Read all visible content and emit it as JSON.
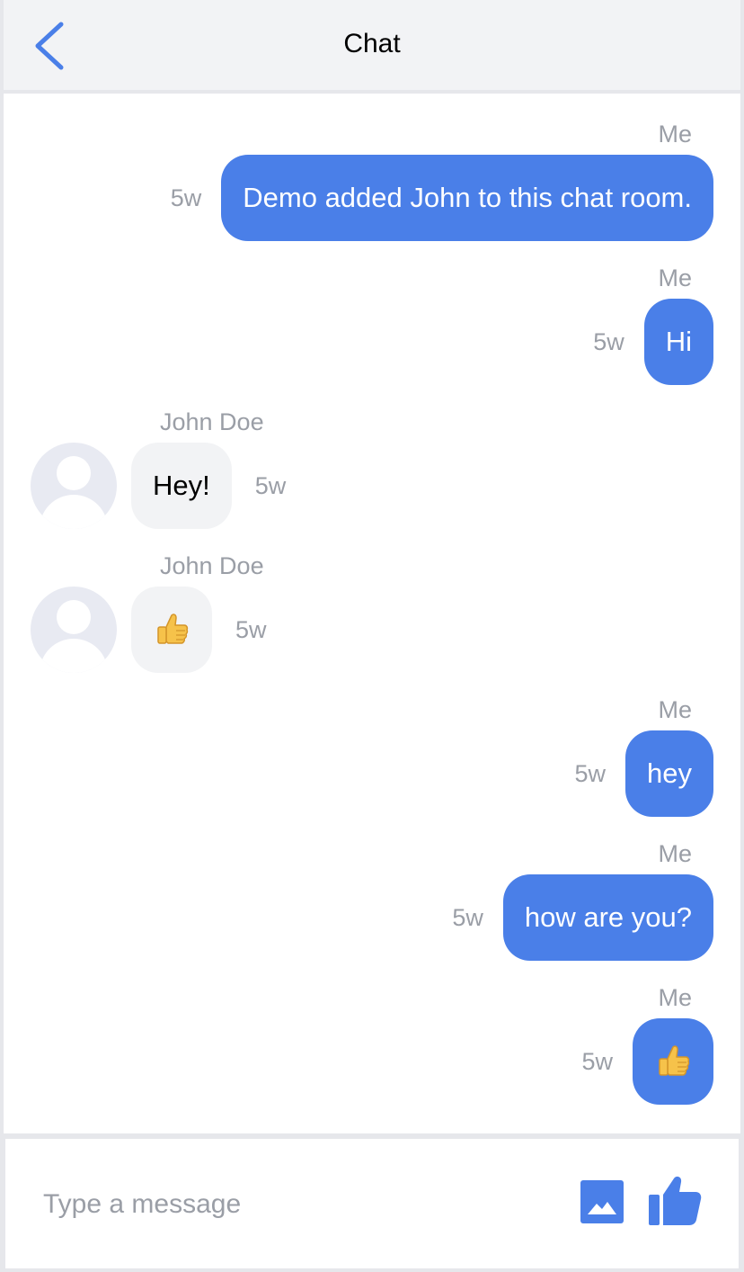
{
  "header": {
    "title": "Chat",
    "back_icon": "chevron-left-icon"
  },
  "colors": {
    "accent": "#4a7fe8",
    "incoming_bubble": "#f2f3f5",
    "muted_text": "#9a9ea6"
  },
  "messages": [
    {
      "sender": "Me",
      "text": "Demo added John to this chat room.",
      "time": "5w",
      "outgoing": true
    },
    {
      "sender": "Me",
      "text": "Hi",
      "time": "5w",
      "outgoing": true
    },
    {
      "sender": "John Doe",
      "text": "Hey!",
      "time": "5w",
      "outgoing": false
    },
    {
      "sender": "John Doe",
      "text": "👍",
      "time": "5w",
      "outgoing": false
    },
    {
      "sender": "Me",
      "text": "hey",
      "time": "5w",
      "outgoing": true
    },
    {
      "sender": "Me",
      "text": "how are you?",
      "time": "5w",
      "outgoing": true
    },
    {
      "sender": "Me",
      "text": "👍",
      "time": "5w",
      "outgoing": true
    }
  ],
  "composer": {
    "placeholder": "Type a message",
    "image_icon": "image-icon",
    "like_icon": "thumbs-up-icon"
  }
}
